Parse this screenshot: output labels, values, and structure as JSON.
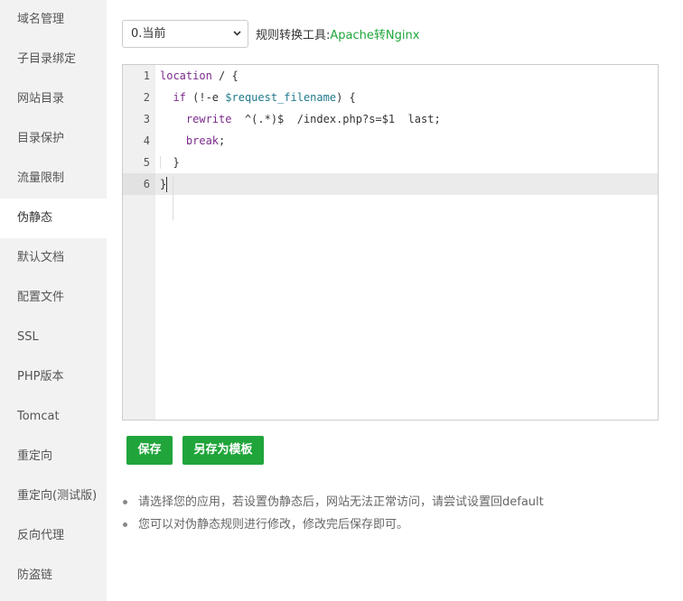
{
  "sidebar": {
    "items": [
      {
        "label": "域名管理",
        "active": false
      },
      {
        "label": "子目录绑定",
        "active": false
      },
      {
        "label": "网站目录",
        "active": false
      },
      {
        "label": "目录保护",
        "active": false
      },
      {
        "label": "流量限制",
        "active": false
      },
      {
        "label": "伪静态",
        "active": true
      },
      {
        "label": "默认文档",
        "active": false
      },
      {
        "label": "配置文件",
        "active": false
      },
      {
        "label": "SSL",
        "active": false
      },
      {
        "label": "PHP版本",
        "active": false
      },
      {
        "label": "Tomcat",
        "active": false
      },
      {
        "label": "重定向",
        "active": false
      },
      {
        "label": "重定向(测试版)",
        "active": false
      },
      {
        "label": "反向代理",
        "active": false
      },
      {
        "label": "防盗链",
        "active": false
      }
    ]
  },
  "toolbar": {
    "select_value": "0.当前",
    "select_icon": "chevron-down-icon",
    "tool_label": "规则转换工具:",
    "tool_link": "Apache转Nginx"
  },
  "editor": {
    "line_numbers": [
      "1",
      "2",
      "3",
      "4",
      "5",
      "6"
    ],
    "lines": [
      "location / {",
      "  if (!-e $request_filename) {",
      "    rewrite  ^(.*)$  /index.php?s=$1  last;",
      "    break;",
      "  }",
      "}"
    ],
    "current_line": 6
  },
  "buttons": {
    "save": "保存",
    "save_as_template": "另存为模板"
  },
  "tips": [
    "请选择您的应用，若设置伪静态后，网站无法正常访问，请尝试设置回default",
    "您可以对伪静态规则进行修改，修改完后保存即可。"
  ],
  "colors": {
    "accent": "#20a53a",
    "sidebar_bg": "#f2f2f2",
    "keyword": "#7a2b8c",
    "variable": "#1f7a8c"
  }
}
